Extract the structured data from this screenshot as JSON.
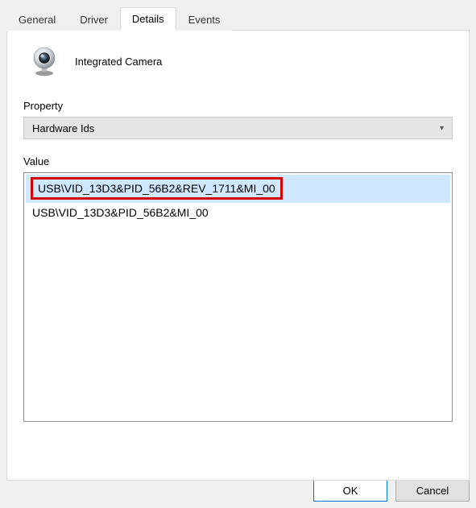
{
  "tabs": {
    "general": "General",
    "driver": "Driver",
    "details": "Details",
    "events": "Events"
  },
  "device": {
    "name": "Integrated Camera"
  },
  "property": {
    "label": "Property",
    "selected": "Hardware Ids"
  },
  "value": {
    "label": "Value",
    "items": [
      "USB\\VID_13D3&PID_56B2&REV_1711&MI_00",
      "USB\\VID_13D3&PID_56B2&MI_00"
    ]
  },
  "buttons": {
    "ok": "OK",
    "cancel": "Cancel"
  }
}
